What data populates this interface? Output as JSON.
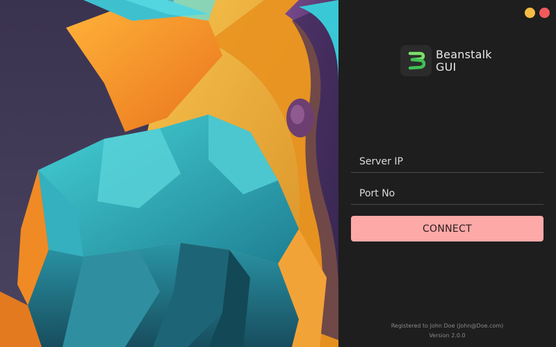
{
  "window": {
    "controls": [
      {
        "name": "minimize",
        "color": "#f6bd45"
      },
      {
        "name": "close",
        "color": "#f05a5a"
      }
    ]
  },
  "artwork": {
    "description_icon": "abstract-3d-artwork",
    "colors": [
      "#3d3752",
      "#f59a2a",
      "#2fb7c4",
      "#6b3a7a",
      "#f3c24a"
    ]
  },
  "brand": {
    "logo_icon": "beanstalk-logo-icon",
    "name_line1": "Beanstalk",
    "name_line2": "GUI",
    "accent": "#5fd36a"
  },
  "form": {
    "server_ip": {
      "value": "",
      "placeholder": "Server IP"
    },
    "port_no": {
      "value": "",
      "placeholder": "Port No"
    },
    "connect_label": "CONNECT",
    "connect_color": "#fca9a8"
  },
  "footer": {
    "registered": "Registered to John Doe (John@Doe.com)",
    "version": "Version 2.0.0"
  }
}
